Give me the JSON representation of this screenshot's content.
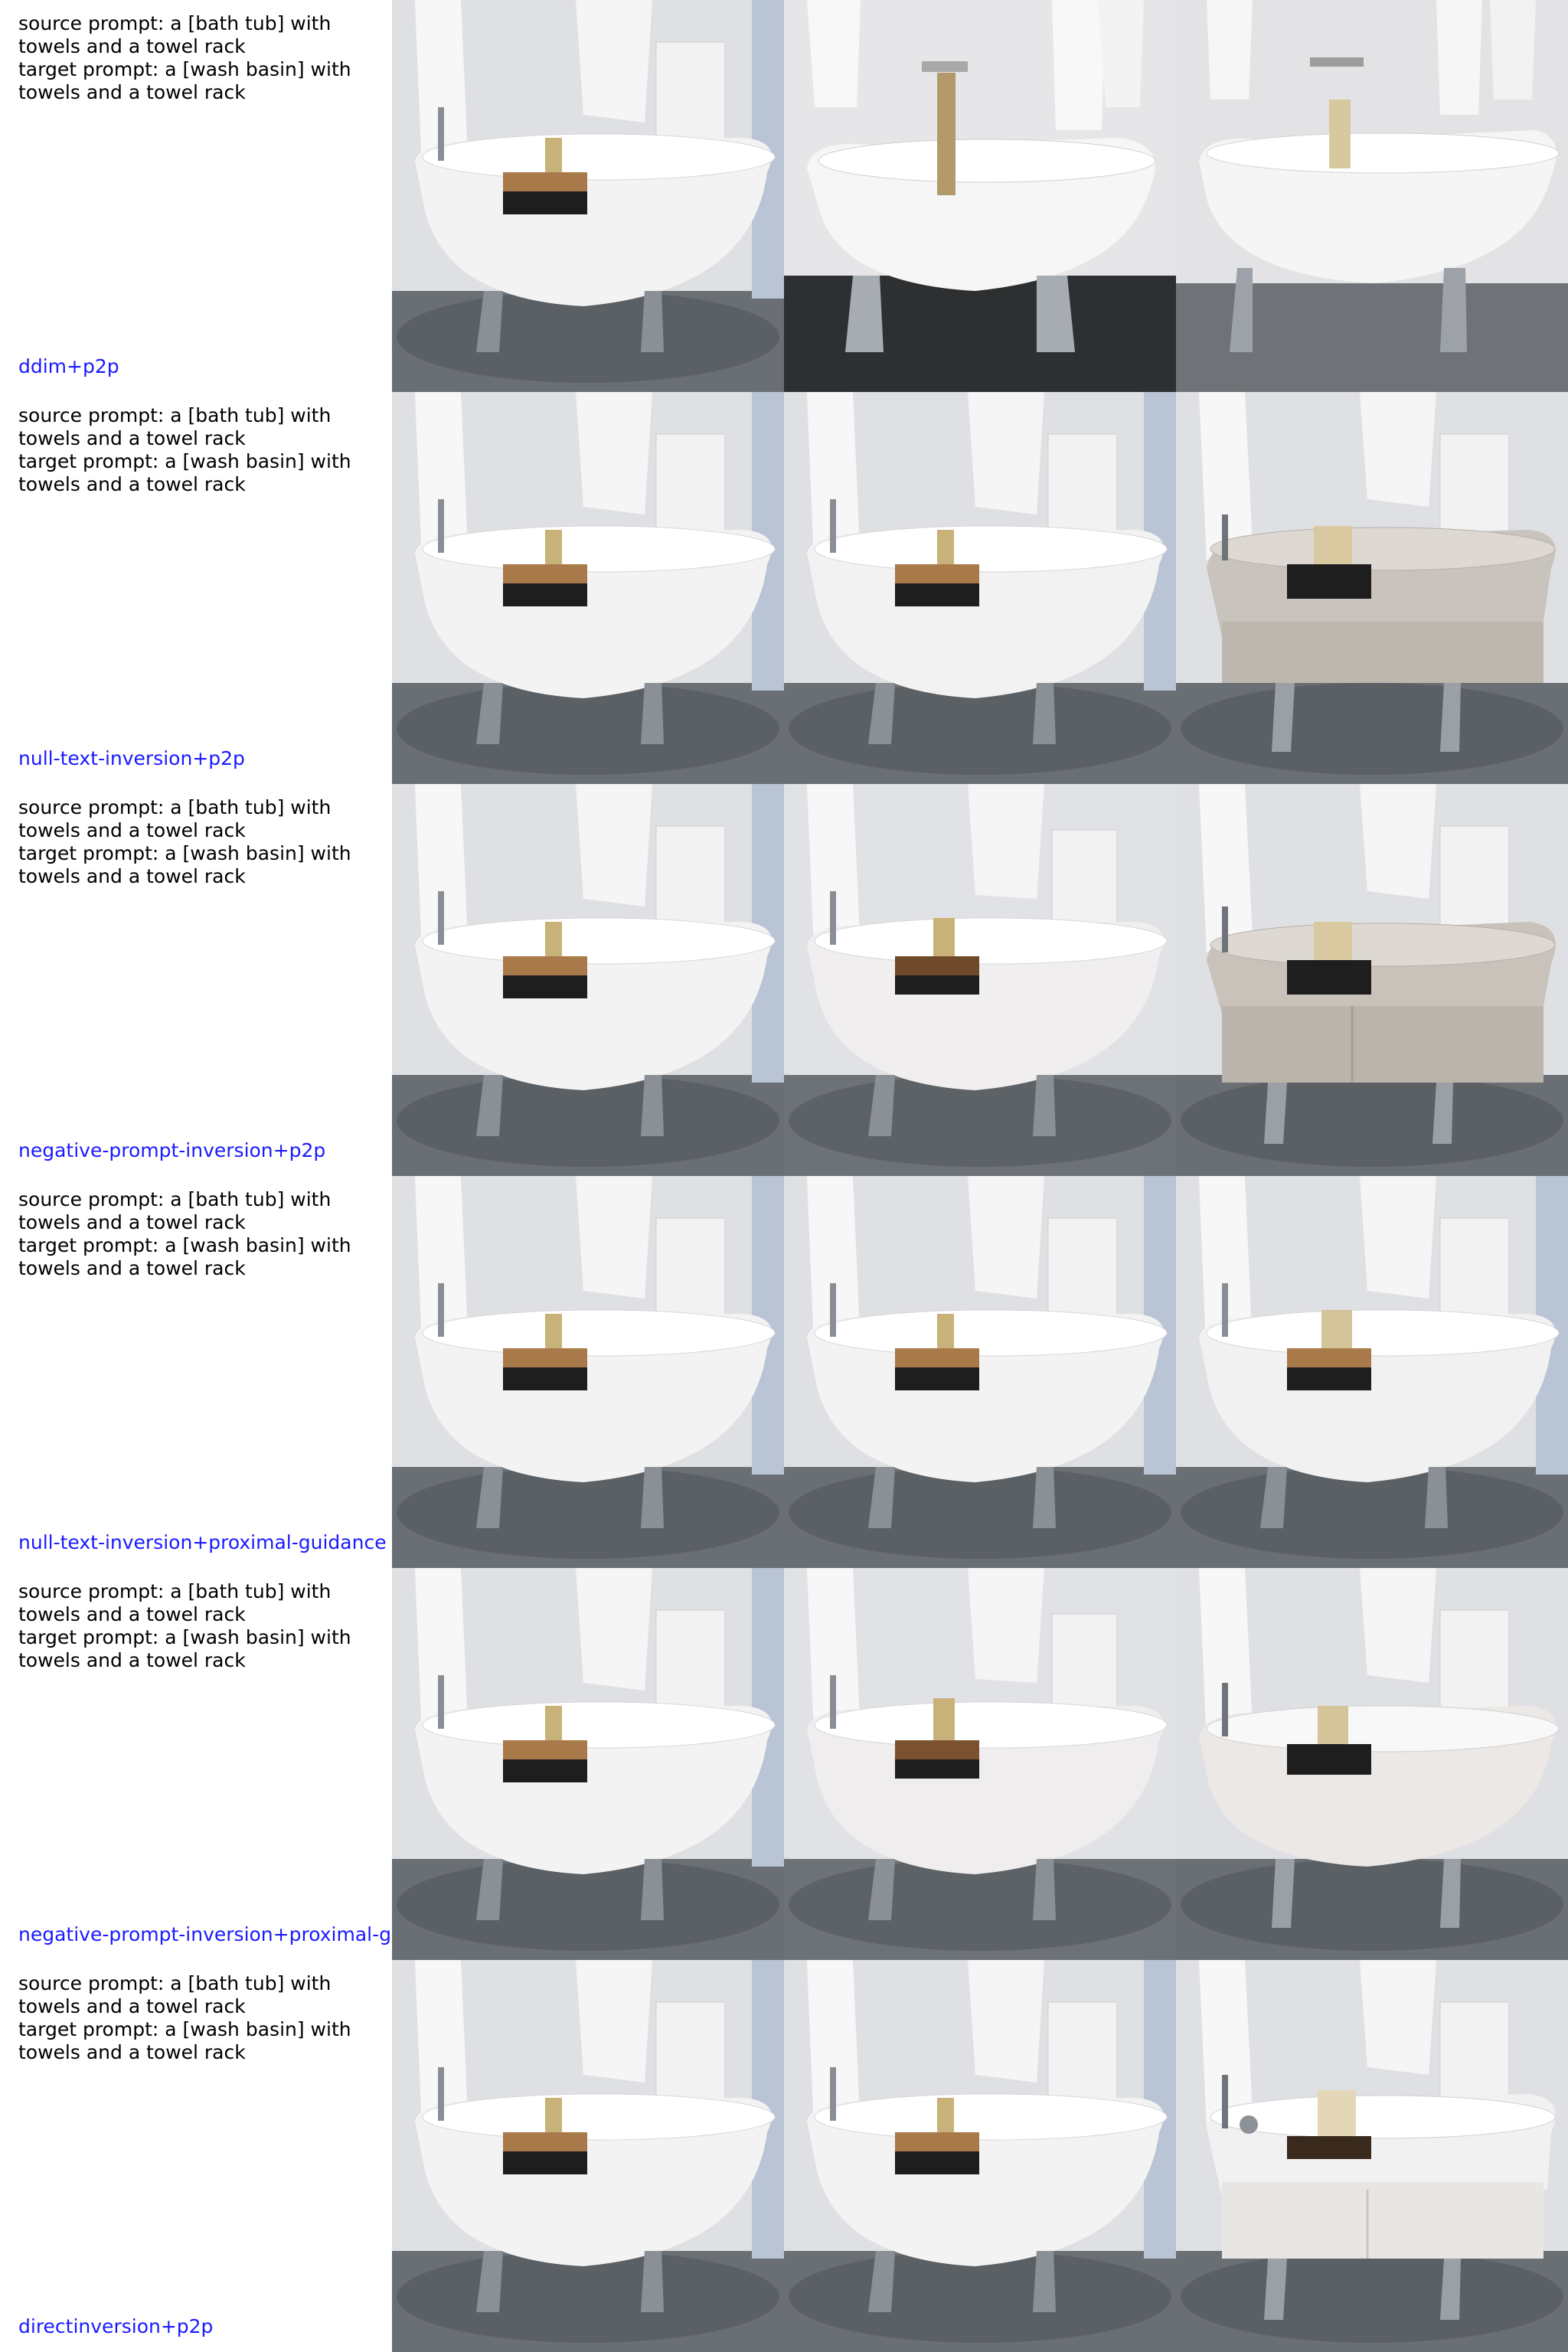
{
  "rows": [
    {
      "prompt": "source prompt: a [bath tub] with\ntowels and a towel rack\ntarget prompt: a [wash basin] with\ntowels and a towel rack",
      "method": "ddim+p2p"
    },
    {
      "prompt": "source prompt: a [bath tub] with\ntowels and a towel rack\ntarget prompt: a [wash basin] with\ntowels and a towel rack",
      "method": "null-text-inversion+p2p"
    },
    {
      "prompt": "source prompt: a [bath tub] with\ntowels and a towel rack\ntarget prompt: a [wash basin] with\ntowels and a towel rack",
      "method": "negative-prompt-inversion+p2p"
    },
    {
      "prompt": "source prompt: a [bath tub] with\ntowels and a towel rack\ntarget prompt: a [wash basin] with\ntowels and a towel rack",
      "method": "null-text-inversion+proximal-guidance"
    },
    {
      "prompt": "source prompt: a [bath tub] with\ntowels and a towel rack\ntarget prompt: a [wash basin] with\ntowels and a towel rack",
      "method": "negative-prompt-inversion+proximal-g"
    },
    {
      "prompt": "source prompt: a [bath tub] with\ntowels and a towel rack\ntarget prompt: a [wash basin] with\ntowels and a towel rack",
      "method": "directinversion+p2p"
    }
  ],
  "colors": {
    "method_label": "#1a1aff",
    "prompt_text": "#000000",
    "wall": "#e4e4e6",
    "floor": "#6b7075",
    "tub": "#f4f4f4",
    "tray": "#a87a4a"
  }
}
